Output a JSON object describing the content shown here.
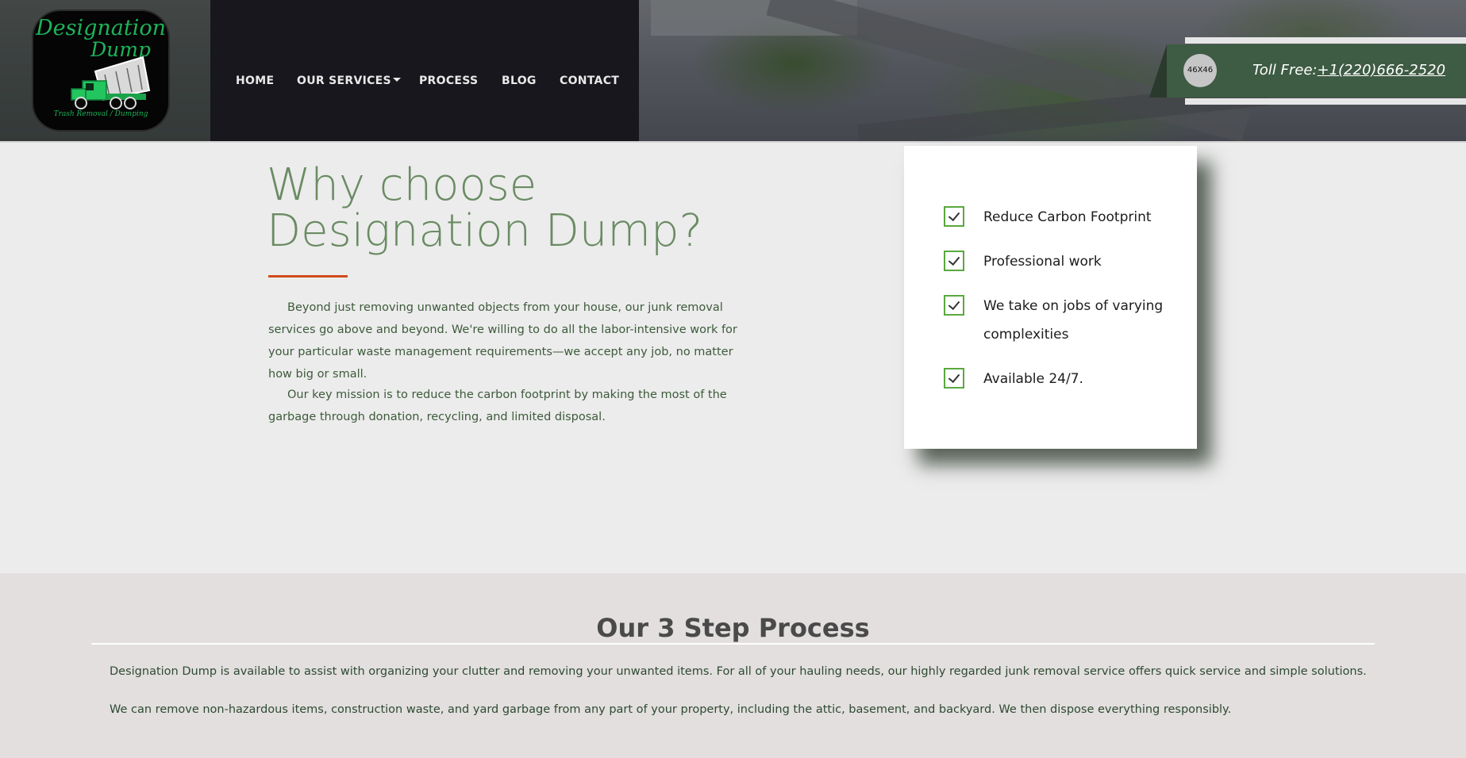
{
  "header": {
    "logo": {
      "line1": "Designation",
      "line2": "Dump",
      "tagline": "Trash Removal / Dumping"
    },
    "nav": {
      "home": "HOME",
      "services": "OUR SERVICES",
      "process": "PROCESS",
      "blog": "BLOG",
      "contact": "CONTACT"
    },
    "phone": {
      "avatar_text": "46X46",
      "label": "Toll Free:",
      "number": "+1(220)666-2520"
    }
  },
  "why": {
    "title_line1": "Why choose",
    "title_line2": "Designation Dump?",
    "paragraph1": "Beyond just removing unwanted objects from your house, our junk removal services go above and beyond. We're willing to do all the labor-intensive work for your particular waste management requirements—we accept any job, no matter how big or small.",
    "paragraph2": "Our key mission is to reduce the carbon footprint by making the most of the garbage through donation, recycling, and limited disposal."
  },
  "features": [
    "Reduce Carbon Footprint",
    "Professional work",
    "We take on jobs of varying complexities",
    "Available 24/7."
  ],
  "process": {
    "title": "Our 3 Step Process",
    "paragraph1": "Designation Dump is available to assist with organizing your clutter and removing your unwanted items. For all of your hauling needs, our highly regarded junk removal service offers quick service and simple solutions.",
    "paragraph2": "We can remove non-hazardous items, construction waste, and yard garbage from any part of your property, including the attic, basement, and backyard. We then dispose everything responsibly."
  },
  "colors": {
    "accent_green": "#6a8b63",
    "underline_orange": "#d24b1a",
    "nav_bg": "#17171d",
    "phone_bg": "#3e5b43",
    "check_green": "#5aa83f"
  }
}
